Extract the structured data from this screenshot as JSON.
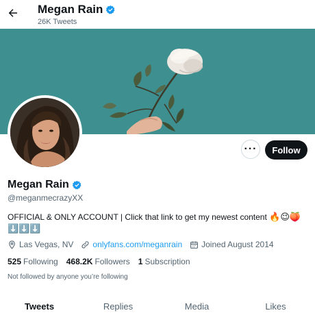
{
  "header": {
    "title": "Megan Rain",
    "tweets_count": "26K Tweets"
  },
  "icons": {
    "back": "arrow-left-icon",
    "verified": "verified-badge-icon",
    "more": "more-dots-icon",
    "location": "location-pin-icon",
    "link": "link-icon",
    "calendar": "calendar-icon"
  },
  "colors": {
    "banner": "#3e8f90",
    "verified": "#1d9bf0",
    "link": "#1d9bf0",
    "follow_button": "#0f1419"
  },
  "profile": {
    "display_name": "Megan Rain",
    "handle": "@meganmecrazyXX",
    "bio_text": "OFFICIAL & ONLY ACCOUNT | Click that link to get my newest content",
    "bio_emojis": "🔥😉🍑",
    "bio_arrows": "⬇️⬇️⬇️",
    "location": "Las Vegas, NV",
    "website": "onlyfans.com/meganrain",
    "joined": "Joined August 2014",
    "follow_label": "Follow",
    "more_label": "···",
    "not_followed_note": "Not followed by anyone you’re following"
  },
  "stats": {
    "following_count": "525",
    "following_label": "Following",
    "followers_count": "468.2K",
    "followers_label": "Followers",
    "subscription_count": "1",
    "subscription_label": "Subscription"
  },
  "tabs": [
    {
      "label": "Tweets",
      "active": true
    },
    {
      "label": "Replies",
      "active": false
    },
    {
      "label": "Media",
      "active": false
    },
    {
      "label": "Likes",
      "active": false
    }
  ]
}
